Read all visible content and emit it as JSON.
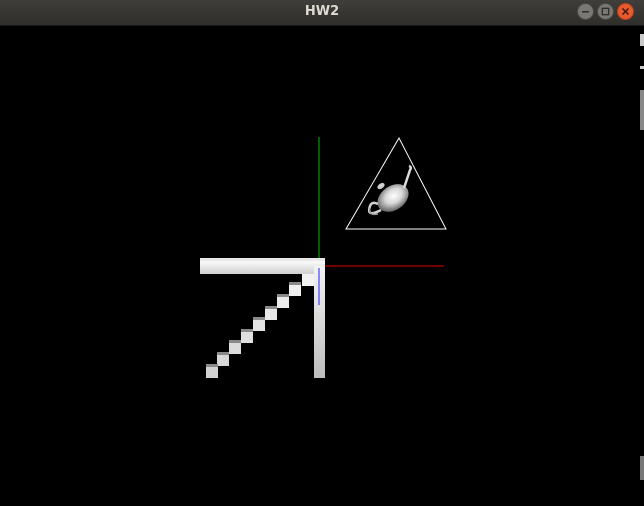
{
  "window": {
    "title": "HW2",
    "buttons": {
      "minimize_icon": "minimize-icon",
      "maximize_icon": "maximize-icon",
      "close_icon": "close-icon"
    }
  },
  "scene": {
    "background": "#000000",
    "axes": {
      "x_color": "#ff0000",
      "y_color": "#00ff00",
      "z_color": "#0000ff"
    },
    "triangle_outline": "#ffffff",
    "objects": [
      "teapot",
      "staircase",
      "axes"
    ]
  }
}
